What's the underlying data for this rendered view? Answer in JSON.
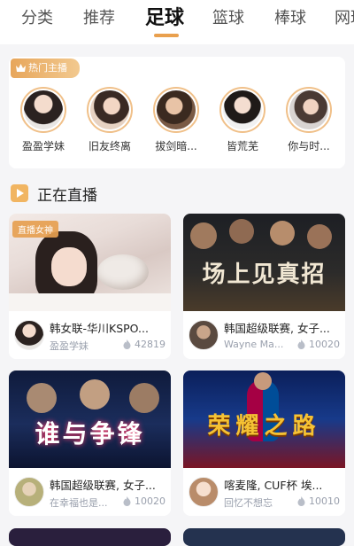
{
  "tabs": [
    {
      "label": "分类"
    },
    {
      "label": "推荐"
    },
    {
      "label": "足球"
    },
    {
      "label": "篮球"
    },
    {
      "label": "棒球"
    },
    {
      "label": "网球"
    }
  ],
  "active_tab": "足球",
  "accent_color": "#e9a04e",
  "hot": {
    "badge": "热门主播",
    "anchors": [
      {
        "name": "盈盈学妹"
      },
      {
        "name": "旧友终离"
      },
      {
        "name": "拔剑暗..."
      },
      {
        "name": "皆荒芜"
      },
      {
        "name": "你与时..."
      }
    ]
  },
  "live": {
    "title": "正在直播",
    "cards": [
      {
        "tag": "直播女神",
        "thumb_text": "",
        "title": "韩女联-华川KSPO...",
        "host": "盈盈学妹",
        "views": "42819"
      },
      {
        "tag": "",
        "thumb_text": "场上见真招",
        "title": "韩国超级联赛, 女子...",
        "host": "Wayne Ma...",
        "views": "10020"
      },
      {
        "tag": "",
        "thumb_text": "谁与争锋",
        "title": "韩国超级联赛, 女子...",
        "host": "在幸福也是...",
        "views": "10020"
      },
      {
        "tag": "",
        "thumb_text": "荣耀之路",
        "title": "喀麦隆, CUF杯 埃...",
        "host": "回忆不想忘",
        "views": "10010"
      }
    ]
  }
}
